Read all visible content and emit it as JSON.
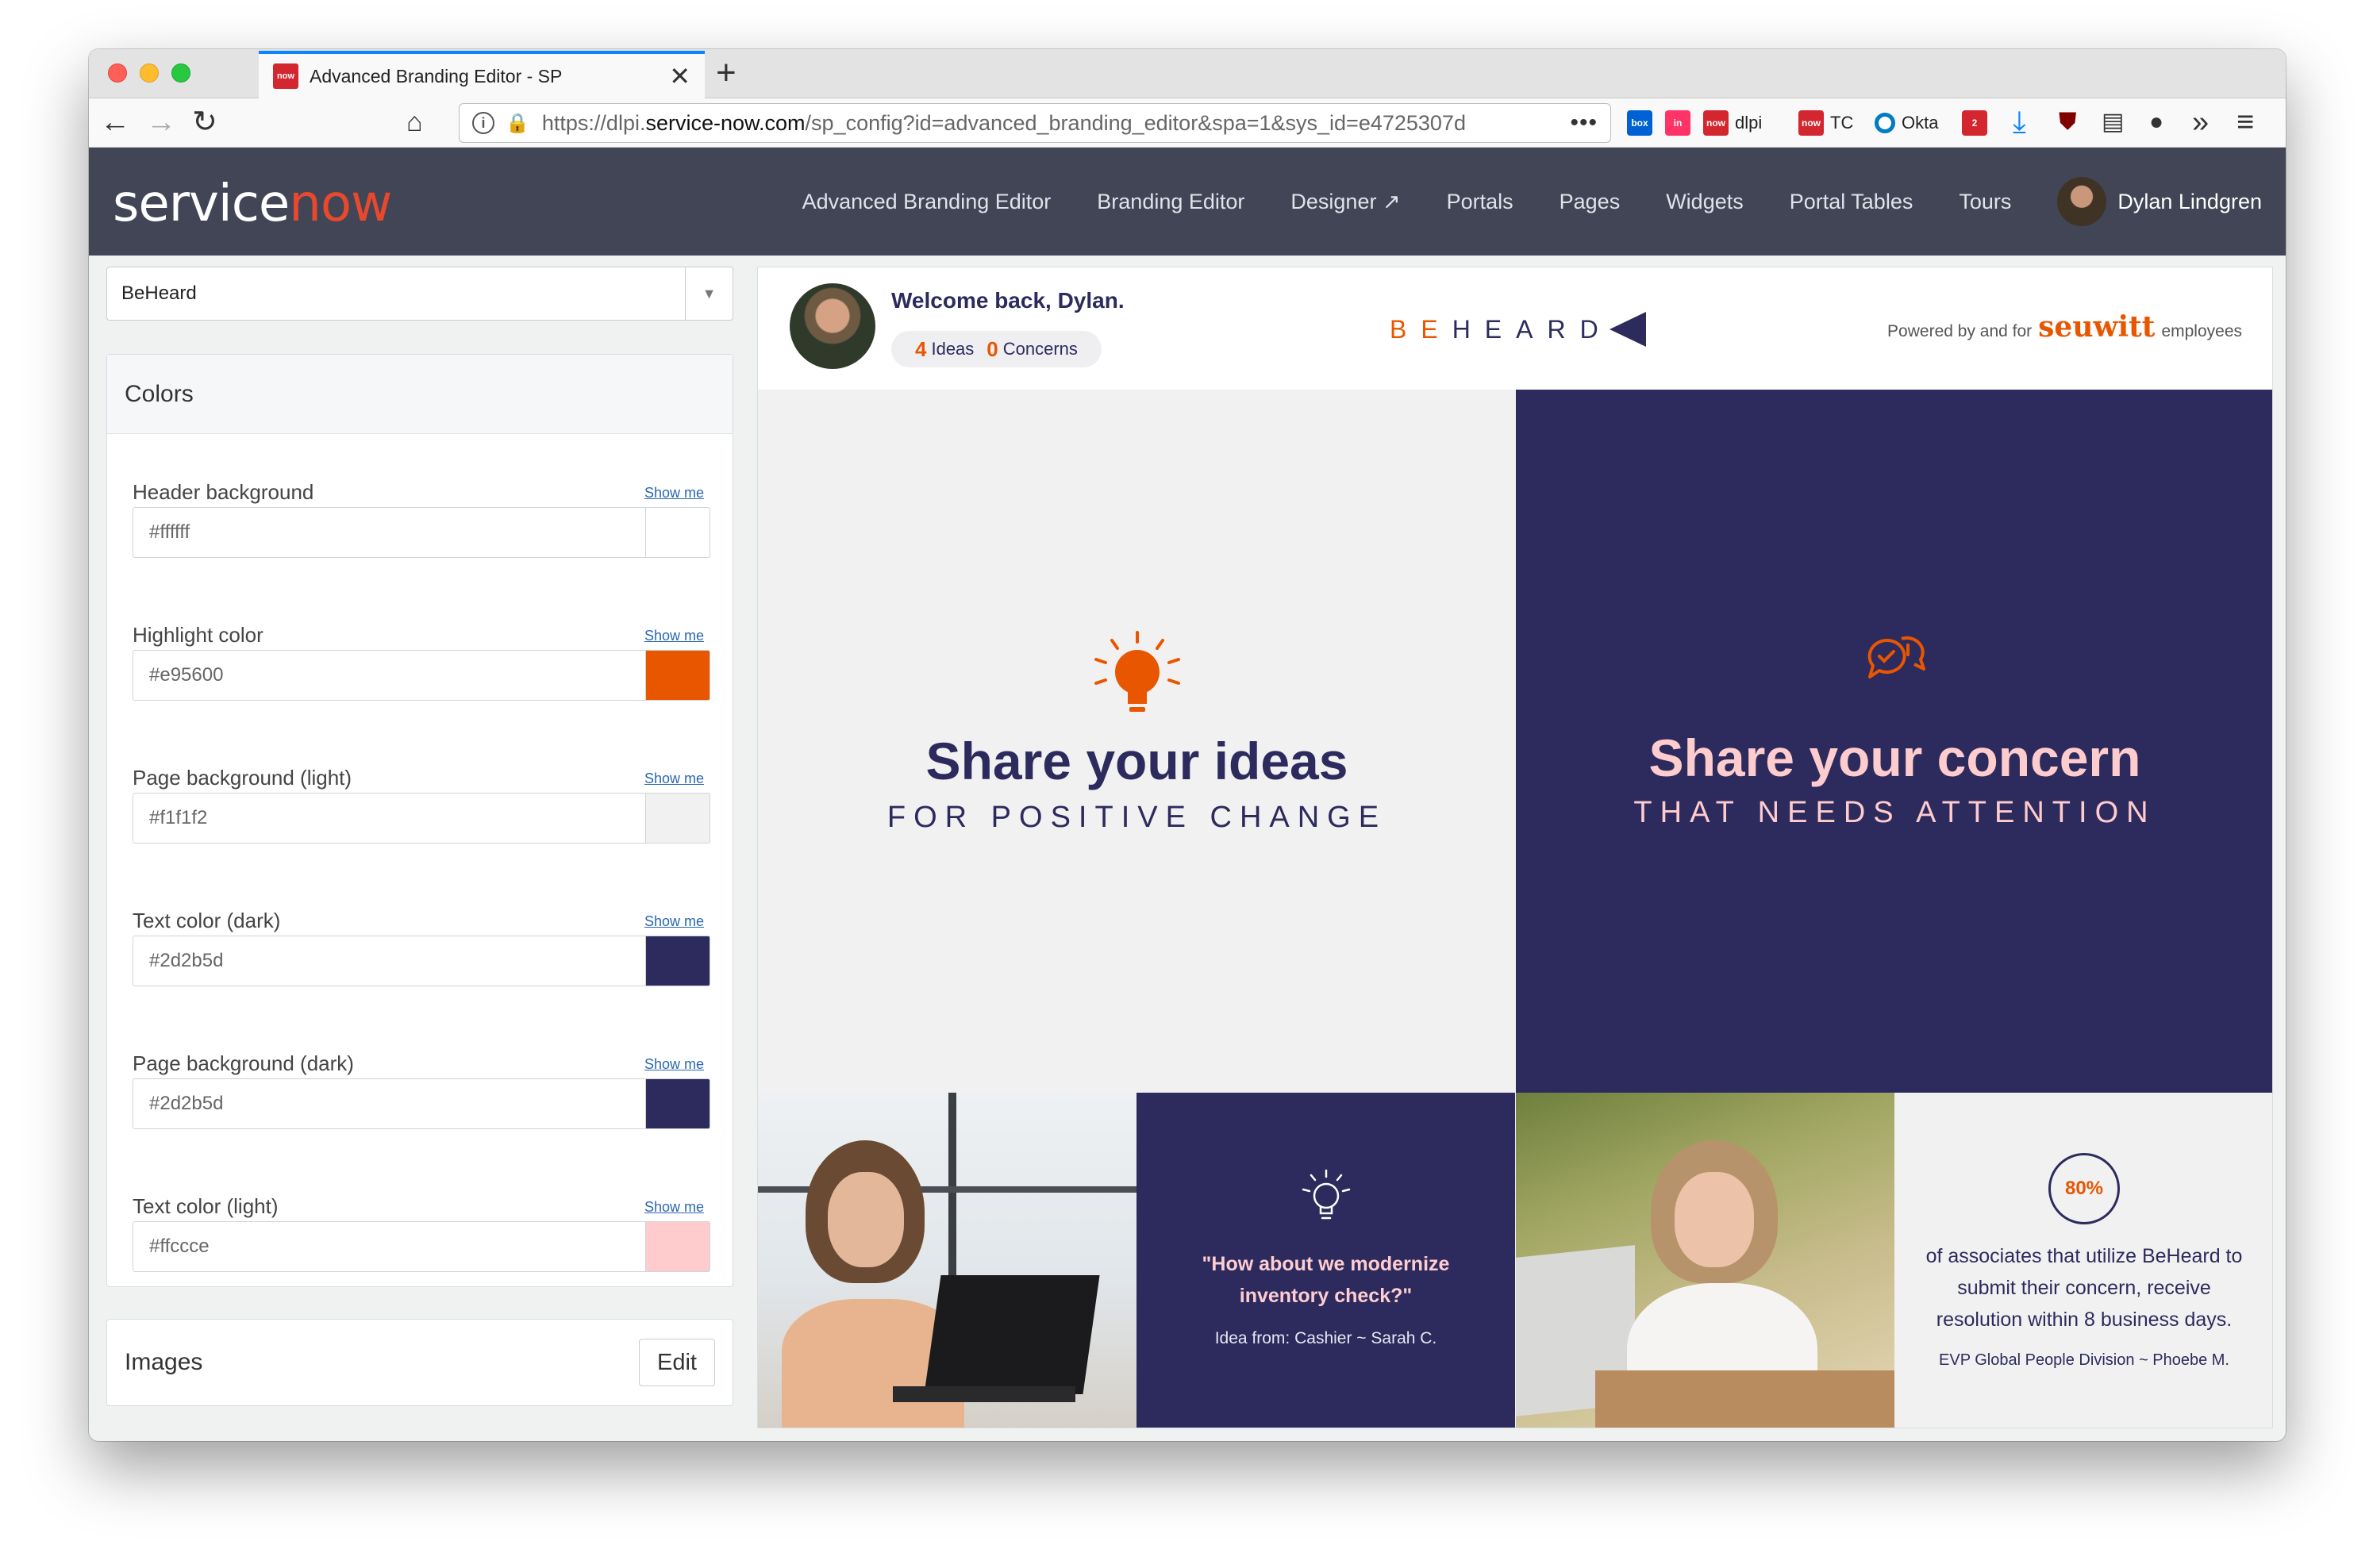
{
  "browser": {
    "tab_title": "Advanced Branding Editor - SP",
    "tab_favicon": "now",
    "url_host_prefix": "https://dlpi.",
    "url_host": "service-now.com",
    "url_path": "/sp_config?id=advanced_branding_editor&spa=1&sys_id=e4725307d",
    "extensions": [
      {
        "icon": "box",
        "label": ""
      },
      {
        "icon": "in",
        "label": ""
      },
      {
        "icon": "now",
        "label": "dlpi"
      },
      {
        "icon": "now",
        "label": "TC"
      },
      {
        "icon": "okta",
        "label": "Okta"
      },
      {
        "icon": "badge",
        "label": "2"
      }
    ]
  },
  "sn_header": {
    "logo_service": "service",
    "logo_now": "now",
    "nav": [
      "Advanced Branding Editor",
      "Branding Editor",
      "Designer ↗",
      "Portals",
      "Pages",
      "Widgets",
      "Portal Tables",
      "Tours"
    ],
    "user_name": "Dylan Lindgren"
  },
  "sidebar": {
    "portal_select": "BeHeard",
    "colors_title": "Colors",
    "show_me": "Show me",
    "colors": [
      {
        "label": "Header background",
        "value": "#ffffff",
        "swatch": "#ffffff"
      },
      {
        "label": "Highlight color",
        "value": "#e95600",
        "swatch": "#e95600"
      },
      {
        "label": "Page background (light)",
        "value": "#f1f1f2",
        "swatch": "#f1f1f2"
      },
      {
        "label": "Text color (dark)",
        "value": "#2d2b5d",
        "swatch": "#2d2b5d"
      },
      {
        "label": "Page background (dark)",
        "value": "#2d2b5d",
        "swatch": "#2d2b5d"
      },
      {
        "label": "Text color (light)",
        "value": "#ffccce",
        "swatch": "#ffccce"
      }
    ],
    "images_title": "Images",
    "edit_label": "Edit"
  },
  "preview": {
    "welcome": "Welcome back, Dylan.",
    "ideas_count": "4",
    "ideas_label": "Ideas",
    "concerns_count": "0",
    "concerns_label": "Concerns",
    "brand_be": "BE",
    "brand_heard": "HEARD",
    "powered_prefix": "Powered by and for",
    "powered_brand": "seuwitt",
    "powered_suffix": "employees",
    "ideas_title": "Share your ideas",
    "ideas_sub": "FOR POSITIVE CHANGE",
    "concern_title": "Share your concern",
    "concern_sub": "THAT NEEDS ATTENTION",
    "quote": "\"How about we modernize inventory check?\"",
    "quote_from": "Idea from: Cashier ~ Sarah C.",
    "stat_value": "80%",
    "stat_text": "of associates that utilize BeHeard to submit their concern, receive resolution within 8 business days.",
    "stat_from": "EVP Global People Division ~ Phoebe M."
  },
  "colors": {
    "highlight": "#e95600",
    "dark": "#2d2b5d",
    "light_text": "#ffccce",
    "sn_header": "#414556"
  }
}
